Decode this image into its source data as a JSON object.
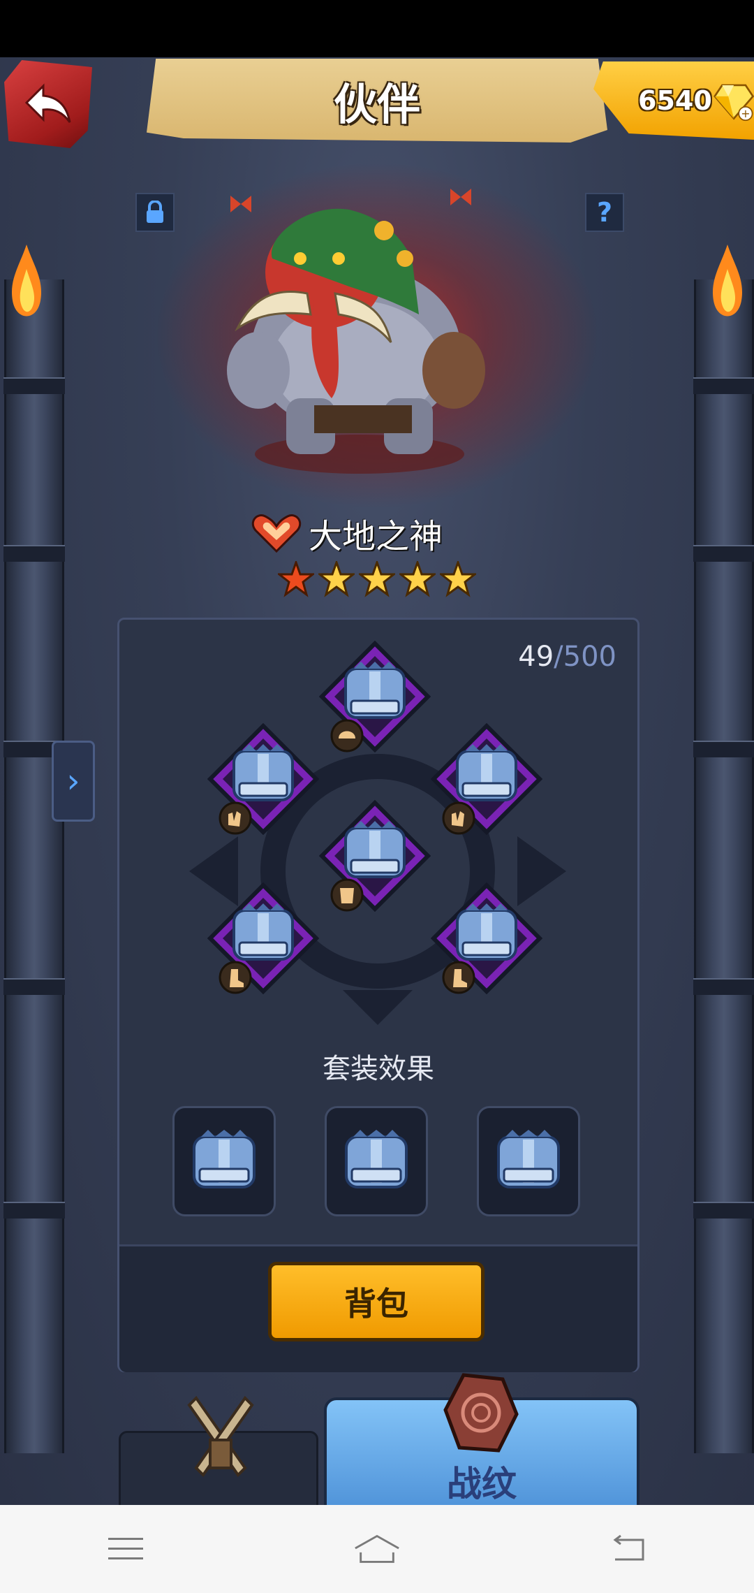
{
  "header": {
    "title": "伙伴",
    "gems": "6540"
  },
  "hero": {
    "name": "大地之神",
    "stars": 5
  },
  "panel": {
    "exp_current": "49",
    "exp_max": "/500",
    "set_title": "套装效果",
    "bag_label": "背包"
  },
  "tabs": {
    "battle_pattern_label": "战纹"
  },
  "icons": {
    "back": "back-arrow-icon",
    "gem": "gem-icon",
    "lock": "lock-icon",
    "help": "question-icon",
    "slots": [
      "helmet-icon",
      "glove-icon",
      "glove-icon",
      "armor-icon",
      "boot-icon",
      "boot-icon"
    ]
  },
  "colors": {
    "accent_orange": "#f5a200",
    "accent_blue": "#5aa6ff",
    "slot_purple": "#7a23b5"
  }
}
